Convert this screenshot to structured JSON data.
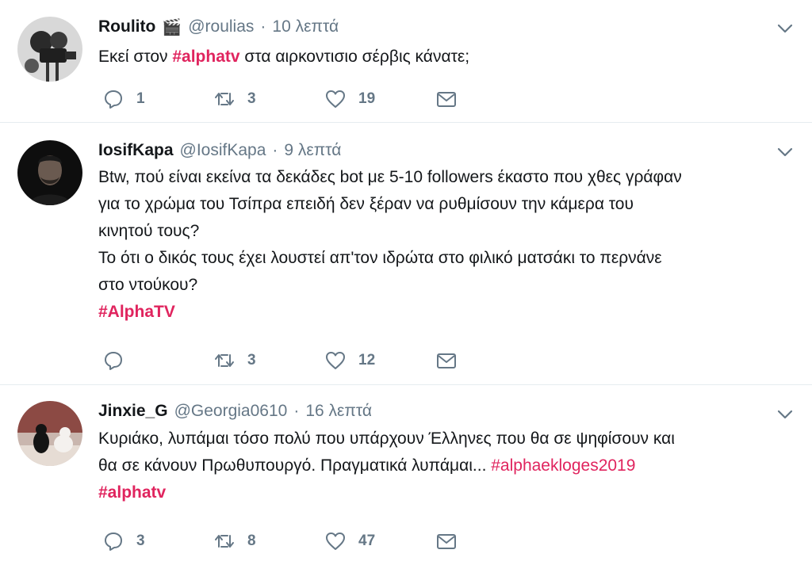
{
  "tweets": [
    {
      "name": "Roulito",
      "badge_emoji": "🎬",
      "handle": "@roulias",
      "separator": "·",
      "time": "10 λεπτά",
      "text_before": "Εκεί στον ",
      "hashtag": "#alphatv",
      "text_after": " στα αιρκοντισιο σέρβις κάνατε;",
      "replies": "1",
      "retweets": "3",
      "likes": "19",
      "avatar_icon": "avatar-film-camera"
    },
    {
      "name": "IosifKapa",
      "handle": "@IosifKapa",
      "separator": "·",
      "time": "9 λεπτά",
      "lines": [
        "Btw, πού είναι εκείνα τα δεκάδες bot με 5-10 followers έκαστο που χθες γράφαν",
        "για το χρώμα του Τσίπρα επειδή δεν ξέραν να ρυθμίσουν την κάμερα του",
        "κινητού τους?",
        "Το ότι ο δικός τους έχει λουστεί απ'τον ιδρώτα στο φιλικό ματσάκι το περνάνε",
        "στο ντούκου?"
      ],
      "hashtag": "#AlphaTV",
      "replies": "",
      "retweets": "3",
      "likes": "12",
      "avatar_icon": "avatar-man-portrait"
    },
    {
      "name": "Jinxie_G",
      "handle": "@Georgia0610",
      "separator": "·",
      "time": "16 λεπτά",
      "line1": "Κυριάκο, λυπάμαι τόσο πολύ που υπάρχουν Έλληνες που θα σε ψηφίσουν και",
      "line2_text": "θα σε κάνουν Πρωθυπουργό. Πραγματικά λυπάμαι... ",
      "line2_hashtag": "#alphaekloges2019",
      "hashtag": "#alphatv",
      "replies": "3",
      "retweets": "8",
      "likes": "47",
      "avatar_icon": "avatar-cats"
    }
  ],
  "icons": {
    "reply": "reply-icon",
    "retweet": "retweet-icon",
    "like": "heart-icon",
    "dm": "envelope-icon",
    "menu": "chevron-down-icon"
  },
  "colors": {
    "hashtag": "#e0245e",
    "secondary_text": "#657786",
    "icon": "#657786",
    "divider": "#e6ecf0"
  }
}
